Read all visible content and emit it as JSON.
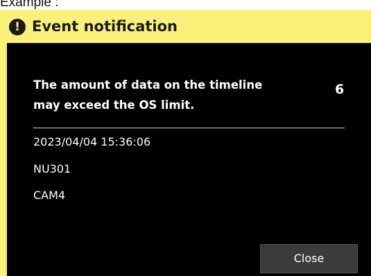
{
  "caption": "Example :",
  "dialog": {
    "title": "Event notification",
    "title_bar_color": "#fbf07a",
    "icon": "exclamation-circle-icon",
    "icon_glyph": "!",
    "message_line1": "The amount of data on the timeline",
    "message_line2": "may exceed the OS limit.",
    "count": "6",
    "timestamp": "2023/04/04 15:36:06",
    "device": "NU301",
    "camera": "CAM4",
    "close_label": "Close"
  }
}
